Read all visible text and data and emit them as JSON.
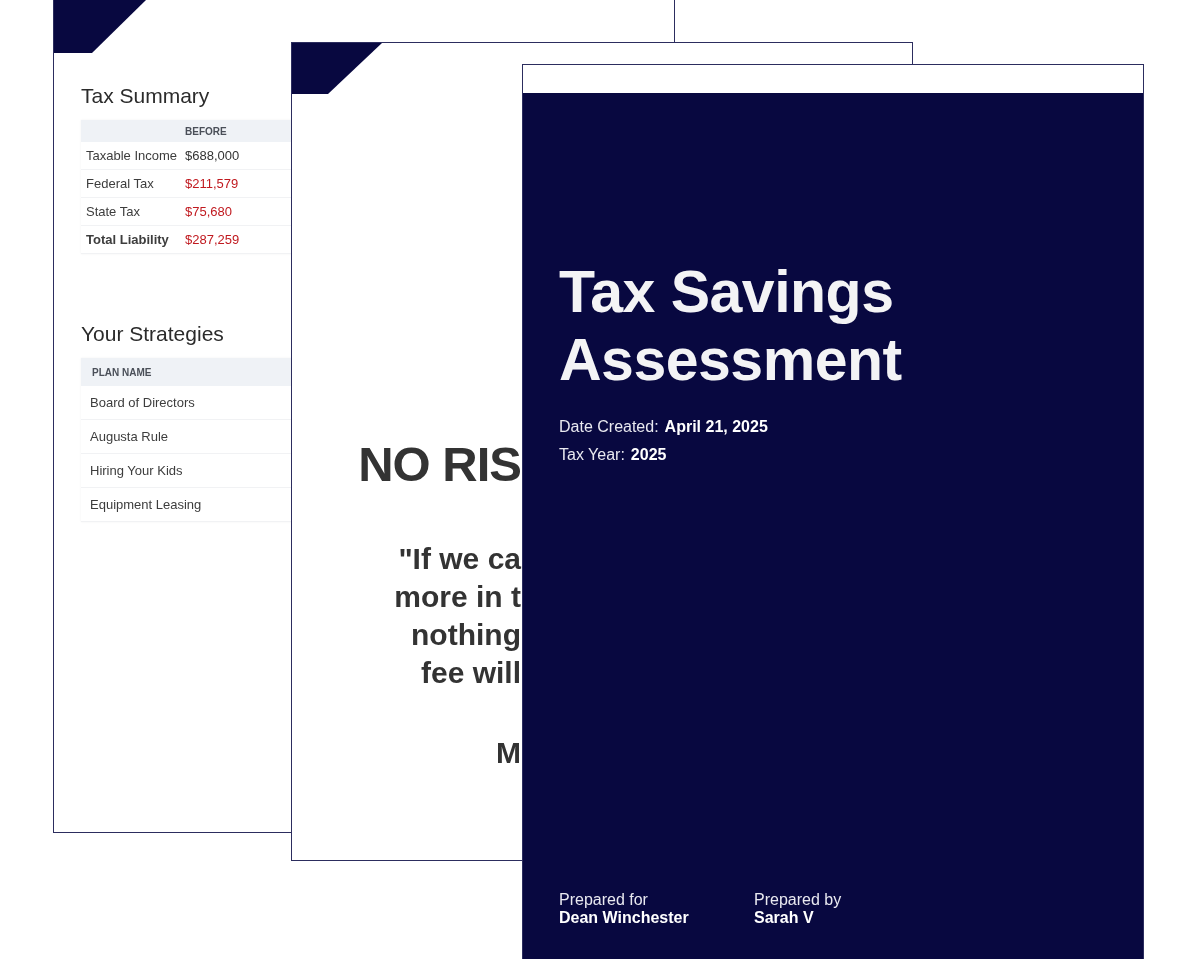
{
  "summary_page": {
    "tax_summary": {
      "title": "Tax Summary",
      "columns": [
        "BEFORE"
      ],
      "rows": [
        {
          "label": "Taxable Income",
          "before": "$688,000",
          "color": "#333333",
          "bold": false
        },
        {
          "label": "Federal Tax",
          "before": "$211,579",
          "color": "#c0191f",
          "bold": false
        },
        {
          "label": "State Tax",
          "before": "$75,680",
          "color": "#c0191f",
          "bold": false
        },
        {
          "label": "Total Liability",
          "before": "$287,259",
          "color": "#c0191f",
          "bold": true
        }
      ]
    },
    "strategies": {
      "title": "Your Strategies",
      "columns": [
        "PLAN NAME"
      ],
      "rows": [
        "Board of Directors",
        "Augusta Rule",
        "Hiring Your Kids",
        "Equipment Leasing"
      ]
    }
  },
  "guarantee_page": {
    "heading": "NO RIS",
    "quote_lines": [
      "\"If we ca",
      "more in t",
      "nothing",
      "fee will"
    ],
    "signature": "M"
  },
  "cover_page": {
    "title": "Tax Savings Assessment",
    "meta": [
      {
        "label": "Date Created:",
        "value": "April 21, 2025"
      },
      {
        "label": "Tax Year:",
        "value": "2025"
      }
    ],
    "prepared": [
      {
        "label": "Prepared for",
        "value": "Dean Winchester"
      },
      {
        "label": "Prepared by",
        "value": "Sarah V"
      }
    ]
  }
}
